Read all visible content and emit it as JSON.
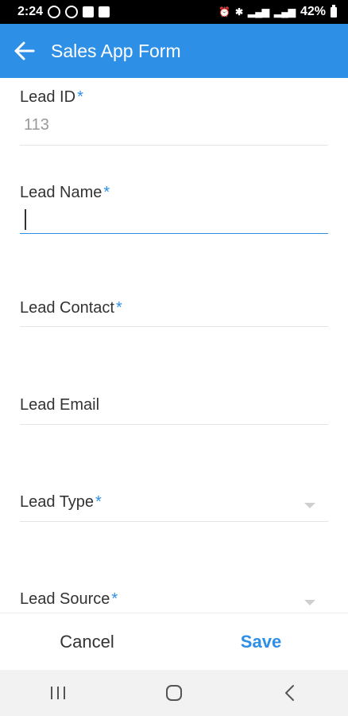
{
  "status_bar": {
    "time": "2:24",
    "battery": "42%"
  },
  "app_bar": {
    "title": "Sales App Form",
    "back_icon": "arrow-left-icon"
  },
  "form": {
    "fields": [
      {
        "label": "Lead ID",
        "required": true,
        "value": "113",
        "type": "readonly"
      },
      {
        "label": "Lead Name",
        "required": true,
        "value": "",
        "type": "text"
      },
      {
        "label": "Lead Contact",
        "required": true,
        "value": "",
        "type": "text"
      },
      {
        "label": "Lead Email",
        "required": false,
        "value": "",
        "type": "text"
      },
      {
        "label": "Lead Type",
        "required": true,
        "value": "",
        "type": "dropdown"
      },
      {
        "label": "Lead Source",
        "required": true,
        "value": "",
        "type": "dropdown"
      }
    ],
    "required_marker": "*"
  },
  "actions": {
    "cancel_label": "Cancel",
    "save_label": "Save"
  },
  "nav_bar": {
    "recents_icon": "recents-icon",
    "home_icon": "home-icon",
    "back_icon": "chevron-left-icon"
  },
  "colors": {
    "accent": "#2d8fe6",
    "text": "#333333",
    "muted": "#9a9a9a"
  }
}
